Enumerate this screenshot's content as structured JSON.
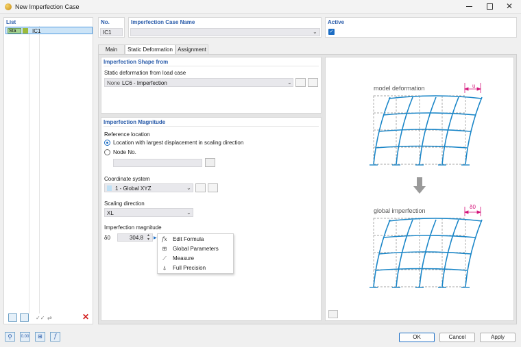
{
  "window": {
    "title": "New Imperfection Case",
    "minimize_icon": "minimize-icon",
    "maximize_icon": "maximize-icon",
    "close_icon": "close-icon"
  },
  "list": {
    "title": "List",
    "items": [
      {
        "badge": "Sta",
        "label": "IC1"
      }
    ]
  },
  "header": {
    "no_label": "No.",
    "no_value": "IC1",
    "name_label": "Imperfection Case Name",
    "name_value": "",
    "active_label": "Active",
    "active_checked": true
  },
  "tabs": [
    {
      "label": "Main",
      "active": false
    },
    {
      "label": "Static Deformation",
      "active": true
    },
    {
      "label": "Assignment",
      "active": false
    }
  ],
  "shape": {
    "title": "Imperfection Shape from",
    "field_label": "Static deformation from load case",
    "none_text": "None",
    "load_case": "LC6 - Imperfection"
  },
  "magnitude": {
    "title": "Imperfection Magnitude",
    "ref_label": "Reference location",
    "option_largest": "Location with largest displacement in scaling direction",
    "option_node": "Node No.",
    "selected_option": "largest",
    "node_value": "",
    "coord_label": "Coordinate system",
    "coord_value": "1 - Global XYZ",
    "scaling_label": "Scaling direction",
    "scaling_value": "XL",
    "imperf_label": "Imperfection magnitude",
    "symbol": "δ0",
    "value": "304.8"
  },
  "context_menu": {
    "items": [
      {
        "icon": "formula-icon",
        "glyph": "fx",
        "label": "Edit Formula"
      },
      {
        "icon": "global-parameters-icon",
        "glyph": "⊞",
        "label": "Global Parameters"
      },
      {
        "icon": "measure-icon",
        "glyph": "⟋",
        "label": "Measure"
      },
      {
        "icon": "full-precision-icon",
        "glyph": "⍋",
        "label": "Full Precision"
      }
    ]
  },
  "diagram": {
    "model_label": "model deformation",
    "model_dim": "u",
    "global_label": "global imperfection",
    "global_dim": "δ0"
  },
  "buttons": {
    "ok": "OK",
    "cancel": "Cancel",
    "apply": "Apply"
  },
  "colors": {
    "accent": "#2a5caa",
    "frame": "#1a86c8",
    "selection": "#cce4f7"
  }
}
